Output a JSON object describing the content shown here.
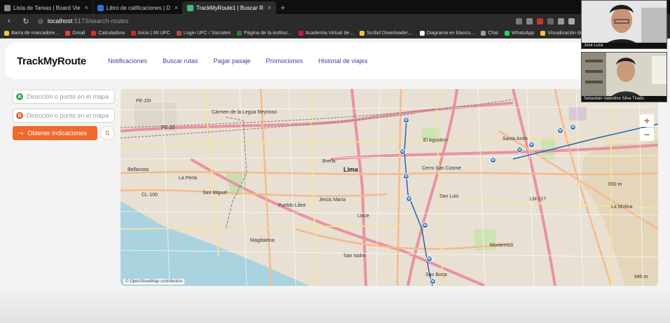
{
  "browser": {
    "tabs": [
      {
        "title": "Lista de Tareas | Board Vie",
        "color": "#8a8a8a",
        "active": false
      },
      {
        "title": "Libro de calificaciones | D",
        "color": "#2f6fd8",
        "active": false
      },
      {
        "title": "TrackMyRoute1 | Buscar R",
        "color": "#3cbf7a",
        "active": true
      }
    ],
    "new_tab": "+",
    "close_glyph": "×",
    "url_host": "localhost",
    "url_path": ":5173/search-routes",
    "bookmarks": [
      {
        "label": "Barra de marcadore...",
        "color": "#f4c542"
      },
      {
        "label": "Gmail",
        "color": "#e8453c"
      },
      {
        "label": "Calculadora",
        "color": "#d93025"
      },
      {
        "label": "Inicio | Mi UPC",
        "color": "#c62828"
      },
      {
        "label": "Login UPC / Socrates",
        "color": "#b04a4a"
      },
      {
        "label": "Página de la instituc...",
        "color": "#2e7d32"
      },
      {
        "label": "Academia Virtual de...",
        "color": "#c2185b"
      },
      {
        "label": "Scribd Downloader,...",
        "color": "#f4c542"
      },
      {
        "label": "Diagrama en blanco...",
        "color": "#f5f5f5"
      },
      {
        "label": "Chat",
        "color": "#9e9e9e"
      },
      {
        "label": "WhatsApp",
        "color": "#25d366"
      },
      {
        "label": "Visualización de Fór...",
        "color": "#f4c542"
      }
    ]
  },
  "app": {
    "logo": "TrackMyRoute",
    "nav": [
      "Notificaciones",
      "Buscar rutas",
      "Pagar pasaje",
      "Promociones",
      "Historial de viajes"
    ]
  },
  "search": {
    "origin": {
      "pin": "A",
      "placeholder": "Dirección o punto en el mapa",
      "value": ""
    },
    "destination": {
      "pin": "B",
      "placeholder": "Dirección o punto en el mapa",
      "value": ""
    },
    "submit_label": "Obtener indicaciones",
    "swap_glyph": "⇅"
  },
  "map": {
    "zoom_in": "+",
    "zoom_out": "−",
    "attribution": "© OpenStreetMap contributors",
    "labels": [
      "Cármen de la Legua Reynoso",
      "El Agustino",
      "Santa Anita",
      "Bellavista",
      "La Perla",
      "San Miguel",
      "Breña",
      "Lima",
      "Jesús María",
      "Pueblo Libre",
      "Lince",
      "San Luis",
      "Magdalena",
      "San Isidro",
      "San Borja",
      "Monterrico",
      "La Molina",
      "Cerro San Cosme",
      "PE-20I",
      "PE-20",
      "LM-117",
      "CL-100",
      "650 m",
      "940 m"
    ]
  },
  "call": {
    "participants": [
      "José Luza",
      "Sebastian Valentino Silva Tirado"
    ]
  }
}
